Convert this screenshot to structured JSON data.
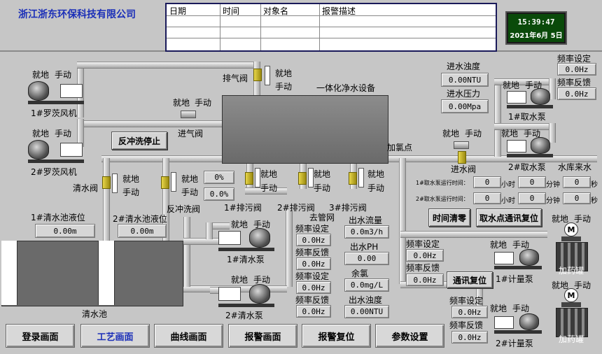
{
  "header": {
    "company": "浙江浙东环保科技有限公司",
    "alarm_columns": [
      "日期",
      "时间",
      "对象名",
      "报警描述"
    ],
    "alarm_rows": 3,
    "clock_time": "15:39:47",
    "clock_date": "2021年6月 5日"
  },
  "labels": {
    "jiudi": "就地",
    "shoudong": "手动",
    "fan1": "1#罗茨风机",
    "fan2": "2#罗茨风机",
    "exhaust_valve": "排气阀",
    "integrated": "一体化净水设备",
    "inlet_valve": "进气阀",
    "backwash_stop": "反冲洗停止",
    "clear_valve": "清水阀",
    "backwash_valve": "反冲洗阀",
    "drain1": "1#排污阀",
    "drain2": "2#排污阀",
    "drain3": "3#排污阀",
    "to_network": "去管网",
    "chlorine_point": "加氯点",
    "inlet_valve2": "进水阀",
    "intake_pump1": "1#取水泵",
    "intake_pump2": "2#取水泵",
    "reservoir": "水库来水",
    "level1": "1#清水池液位",
    "level2": "2#清水池液位",
    "clear_pool": "清水池",
    "clear_pump1": "1#清水泵",
    "clear_pump2": "2#清水泵",
    "freq_set": "频率设定",
    "freq_fb": "频率反馈",
    "out_flow": "出水流量",
    "out_ph": "出水PH",
    "residual_cl": "余氯",
    "out_turb": "出水浊度",
    "in_turb": "进水浊度",
    "in_press": "进水压力",
    "pump1_run": "1#取水泵运行时间：",
    "pump2_run": "2#取水泵运行时间：",
    "hour": "小时",
    "minute": "分钟",
    "second": "秒",
    "metering1": "1#计量泵",
    "metering2": "2#计量泵",
    "dosing_tank": "加药罐",
    "mixer_m": "M"
  },
  "values": {
    "backwash_pct": "0%",
    "backwash_pct2": "0.0%",
    "level1": "0.00m",
    "level2": "0.00m",
    "cp1_set": "0.0Hz",
    "cp1_fb": "0.0Hz",
    "cp2_set": "0.0Hz",
    "cp2_fb": "0.0Hz",
    "flow": "0.0m3/h",
    "ph": "0.00",
    "cl": "0.0mg/L",
    "out_turb": "0.00NTU",
    "in_turb": "0.00NTU",
    "in_press": "0.00Mpa",
    "ip_set": "0.0Hz",
    "ip_fb": "0.0Hz",
    "p1_zero": "0",
    "mp1_set": "0.0Hz",
    "mp1_fb": "0.0Hz",
    "mp2_set": "0.0Hz",
    "mp2_fb": "0.0Hz"
  },
  "buttons": {
    "time_clear": "时间清零",
    "intake_reset": "取水点通讯复位",
    "comm_reset": "通讯复位"
  },
  "nav": [
    "登录画面",
    "工艺画面",
    "曲线画面",
    "报警画面",
    "报警复位",
    "参数设置"
  ],
  "colors": {
    "company": "#1b2fb8",
    "clock_bg": "#0a4a0a",
    "clock_fg": "#ffffff",
    "active_nav": "#1b2fb8"
  }
}
